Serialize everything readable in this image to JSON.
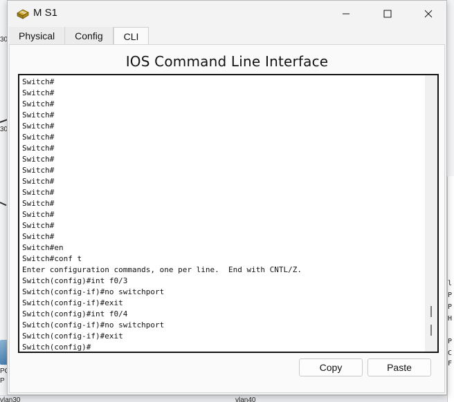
{
  "background": {
    "fragments": [
      "30",
      "30",
      "PC",
      "P",
      "vlan30",
      "vlan40"
    ],
    "right_panel_lines": [
      "l",
      "P",
      "P",
      "H",
      "P",
      "C",
      "F"
    ]
  },
  "window": {
    "title": "M S1",
    "controls": {
      "minimize": "minimize",
      "maximize": "maximize",
      "close": "close"
    }
  },
  "tabs": [
    {
      "label": "Physical",
      "active": false
    },
    {
      "label": "Config",
      "active": false
    },
    {
      "label": "CLI",
      "active": true
    }
  ],
  "cli": {
    "heading": "IOS Command Line Interface",
    "lines": [
      "Switch#",
      "Switch#",
      "Switch#",
      "Switch#",
      "Switch#",
      "Switch#",
      "Switch#",
      "Switch#",
      "Switch#",
      "Switch#",
      "Switch#",
      "Switch#",
      "Switch#",
      "Switch#",
      "Switch#",
      "Switch#en",
      "Switch#conf t",
      "Enter configuration commands, one per line.  End with CNTL/Z.",
      "Switch(config)#int f0/3",
      "Switch(config-if)#no switchport",
      "Switch(config-if)#exit",
      "Switch(config)#int f0/4",
      "Switch(config-if)#no switchport",
      "Switch(config-if)#exit",
      "Switch(config)#"
    ]
  },
  "buttons": {
    "copy": "Copy",
    "paste": "Paste"
  },
  "icons": {
    "app": "switch-device-icon"
  }
}
